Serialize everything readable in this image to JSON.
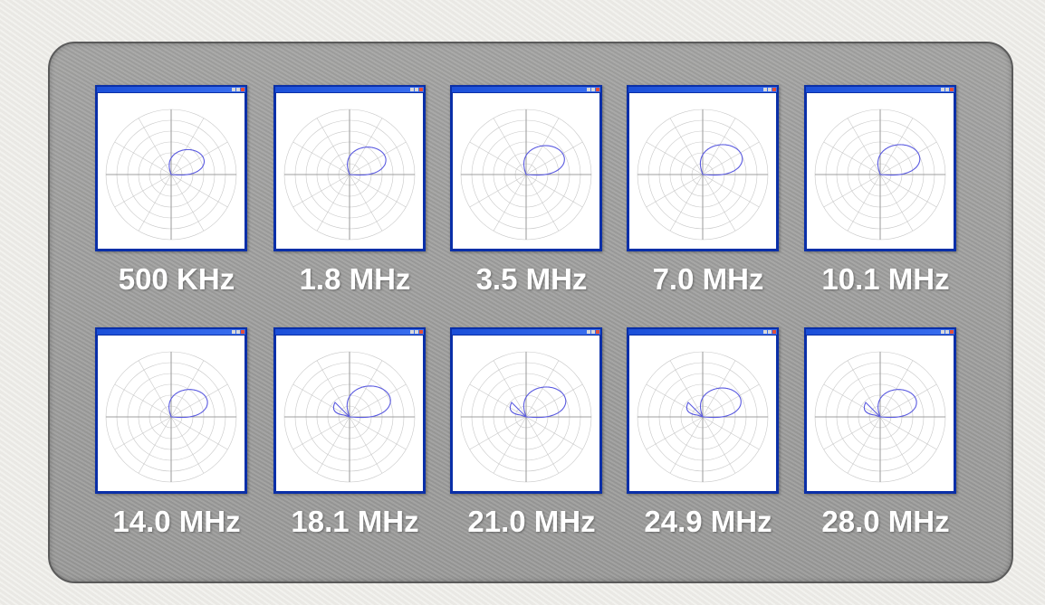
{
  "slide": {
    "accent": "#0a2fa8",
    "panel_color": "#9f9f9e",
    "label_color": "#ffffff",
    "pattern_color": "#5a5ae0",
    "grid_color": "#c8c8c8"
  },
  "plots": [
    {
      "label": "500 KHz",
      "max_gain": 0.5,
      "lobe": 0
    },
    {
      "label": "1.8 MHz",
      "max_gain": 0.55,
      "lobe": 0
    },
    {
      "label": "3.5 MHz",
      "max_gain": 0.58,
      "lobe": 0
    },
    {
      "label": "7.0 MHz",
      "max_gain": 0.6,
      "lobe": 0
    },
    {
      "label": "10.1 MHz",
      "max_gain": 0.6,
      "lobe": 0
    },
    {
      "label": "14.0 MHz",
      "max_gain": 0.55,
      "lobe": 0
    },
    {
      "label": "18.1 MHz",
      "max_gain": 0.62,
      "lobe": 1
    },
    {
      "label": "21.0 MHz",
      "max_gain": 0.6,
      "lobe": 1
    },
    {
      "label": "24.9 MHz",
      "max_gain": 0.58,
      "lobe": 1
    },
    {
      "label": "28.0 MHz",
      "max_gain": 0.55,
      "lobe": 1
    }
  ]
}
